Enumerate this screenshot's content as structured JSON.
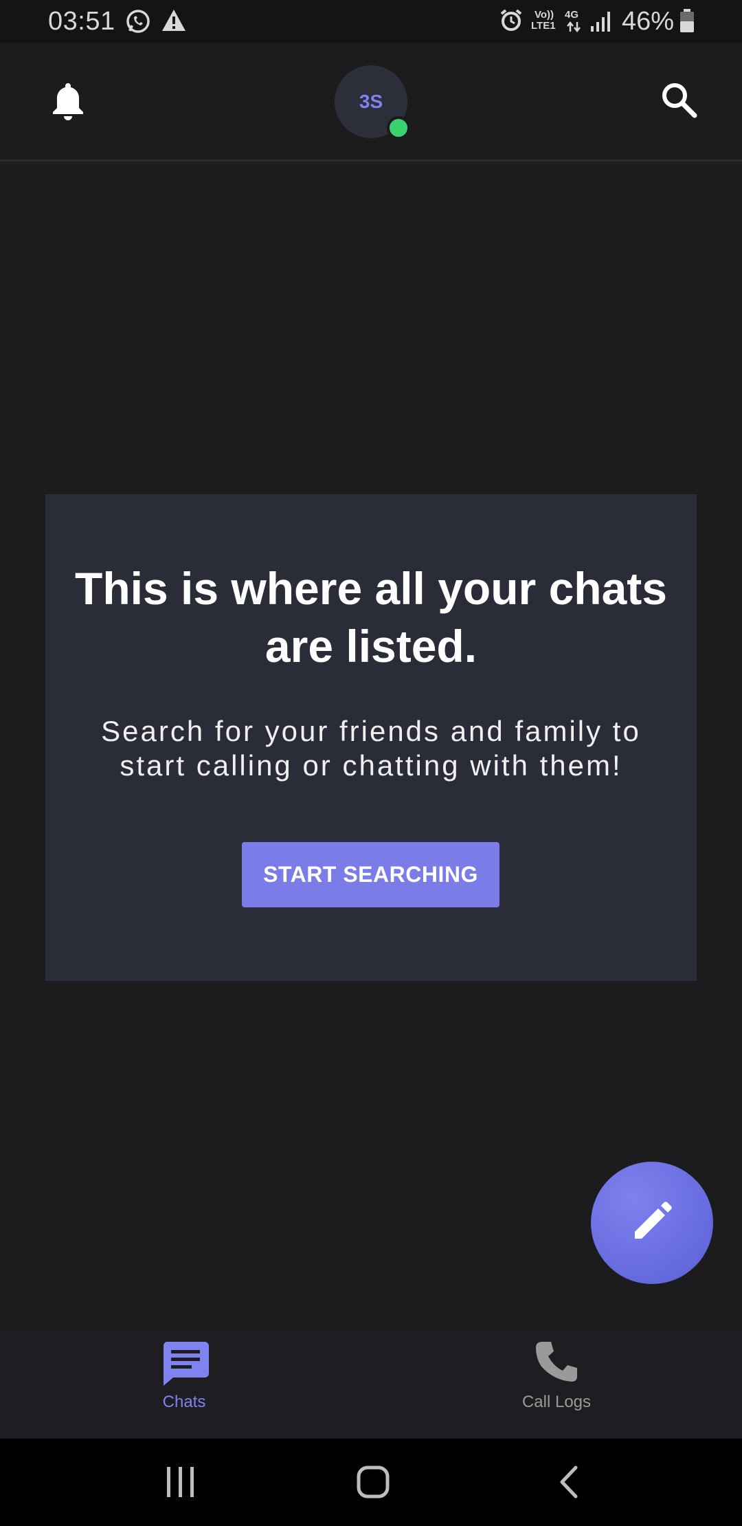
{
  "status_bar": {
    "time": "03:51",
    "battery": "46%",
    "volte": "Vo))",
    "lte": "LTE1",
    "network": "4G",
    "icons": [
      "whatsapp-icon",
      "warning-icon",
      "alarm-icon",
      "signal-icon",
      "battery-icon"
    ]
  },
  "header": {
    "avatar_initials": "3S",
    "presence_color": "#3bd16f"
  },
  "empty_state": {
    "title": "This is where all your chats are listed.",
    "body": "Search for your friends and family to start calling or chatting with them!",
    "button_label": "START SEARCHING"
  },
  "bottom_nav": {
    "items": [
      {
        "label": "Chats",
        "icon": "chat-icon",
        "active": true
      },
      {
        "label": "Call Logs",
        "icon": "phone-icon",
        "active": false
      }
    ]
  },
  "colors": {
    "accent": "#7a7de8",
    "background": "#1c1c1f",
    "card": "#2a2d38"
  }
}
